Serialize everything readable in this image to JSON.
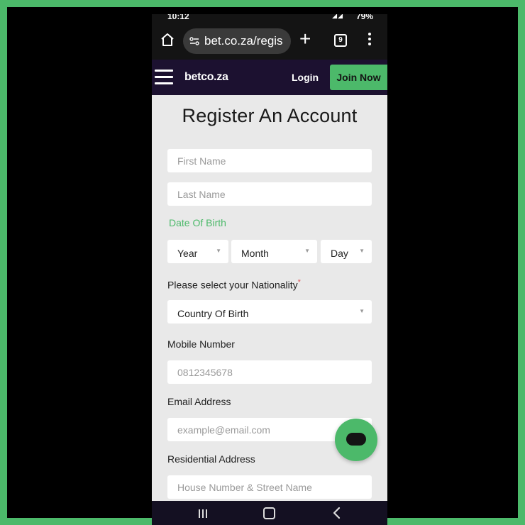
{
  "status_bar": {
    "time": "10:12",
    "battery": "79%"
  },
  "browser": {
    "url": "bet.co.za/regis",
    "tab_count": "9",
    "plus": "+"
  },
  "site_header": {
    "logo": "betco.za",
    "login_label": "Login",
    "join_label": "Join Now"
  },
  "form": {
    "title": "Register An Account",
    "first_name_placeholder": "First Name",
    "last_name_placeholder": "Last Name",
    "dob_label": "Date Of Birth",
    "year": "Year",
    "month": "Month",
    "day": "Day",
    "nationality_label": "Please select your Nationality",
    "required_mark": "*",
    "country_select": "Country Of Birth",
    "mobile_label": "Mobile Number",
    "mobile_placeholder": "0812345678",
    "email_label": "Email Address",
    "email_placeholder": "example@email.com",
    "address_label": "Residential Address",
    "address_placeholder": "House Number & Street Name"
  },
  "colors": {
    "accent": "#4cb96a",
    "header_bg": "#1c1130",
    "page_bg": "#e9e9e9"
  }
}
